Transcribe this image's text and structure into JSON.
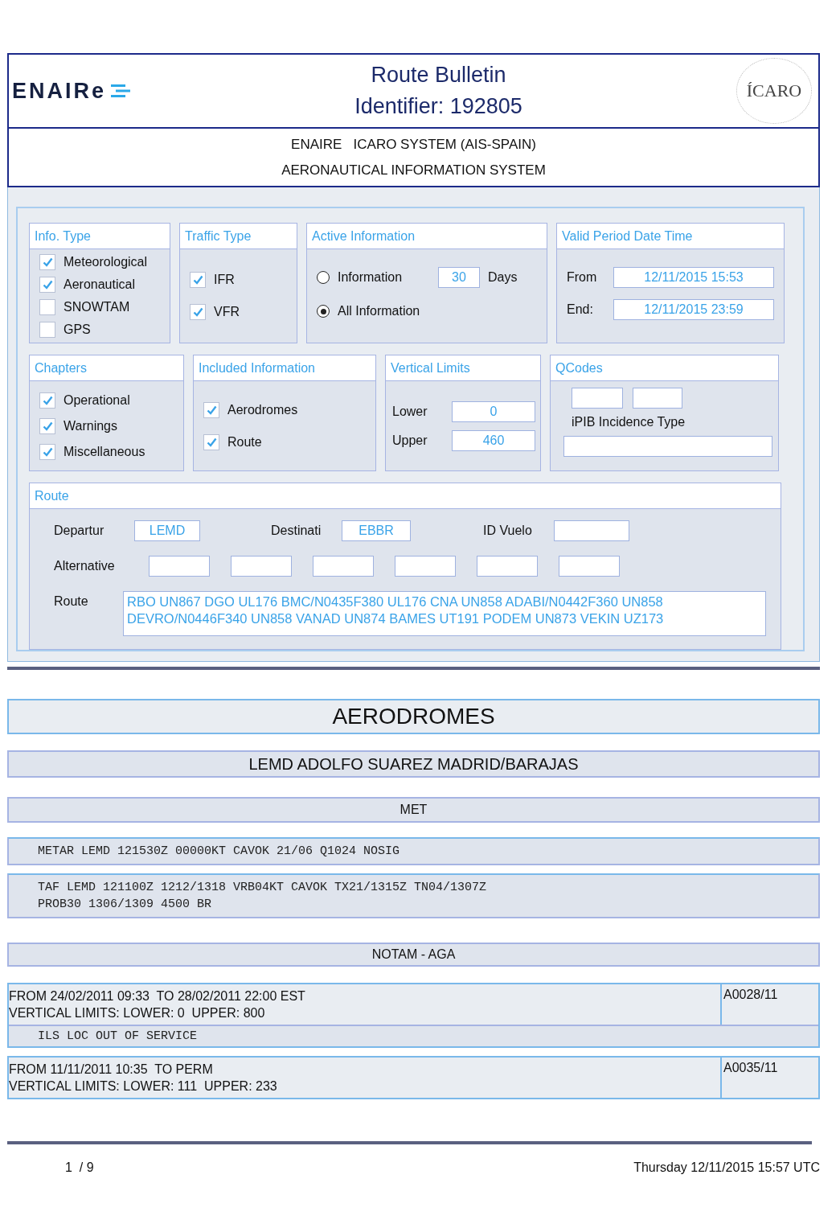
{
  "header": {
    "logo": "ENAIRe",
    "title": "Route Bulletin",
    "identifier": "Identifier: 192805",
    "emblem": "ÍCARO",
    "subtitle_lines": [
      "ENAIRE   ICARO SYSTEM (AIS-SPAIN)",
      "AERONAUTICAL INFORMATION SYSTEM"
    ]
  },
  "info_type": {
    "title": "Info. Type",
    "options": [
      {
        "label": "Meteorological",
        "checked": true
      },
      {
        "label": "Aeronautical",
        "checked": true
      },
      {
        "label": "SNOWTAM",
        "checked": false
      },
      {
        "label": "GPS",
        "checked": false
      }
    ]
  },
  "traffic_type": {
    "title": "Traffic Type",
    "options": [
      {
        "label": "IFR",
        "checked": true
      },
      {
        "label": "VFR",
        "checked": true
      }
    ]
  },
  "active_information": {
    "title": "Active Information",
    "options": [
      {
        "label": "Information",
        "selected": false,
        "value": "30",
        "unit": "Days"
      },
      {
        "label": "All Information",
        "selected": true
      }
    ]
  },
  "valid_period": {
    "title": "Valid Period Date Time",
    "fields": [
      {
        "label": "From",
        "value": "12/11/2015 15:53"
      },
      {
        "label": "End:",
        "value": "12/11/2015 23:59"
      }
    ]
  },
  "chapters": {
    "title": "Chapters",
    "options": [
      {
        "label": "Operational",
        "checked": true
      },
      {
        "label": "Warnings",
        "checked": true
      },
      {
        "label": "Miscellaneous",
        "checked": true
      }
    ]
  },
  "included_information": {
    "title": "Included Information",
    "options": [
      {
        "label": "Aerodromes",
        "checked": true
      },
      {
        "label": "Route",
        "checked": true
      }
    ]
  },
  "vertical_limits": {
    "title": "Vertical Limits",
    "fields": [
      {
        "label": "Lower",
        "value": "0"
      },
      {
        "label": "Upper",
        "value": "460"
      }
    ]
  },
  "qcodes": {
    "title": "QCodes",
    "incidence_label": "iPIB Incidence Type"
  },
  "route": {
    "title": "Route",
    "departure_label": "Departur",
    "departure": "LEMD",
    "destination_label": "Destinati",
    "destination": "EBBR",
    "flight_id_label": "ID Vuelo",
    "alternative_label": "Alternative",
    "route_label": "Route",
    "route_lines": [
      "RBO UN867 DGO UL176 BMC/N0435F380 UL176 CNA UN858 ADABI/N0442F360 UN858",
      "DEVRO/N0446F340 UN858 VANAD UN874 BAMES UT191 PODEM UN873 VEKIN UZ173"
    ]
  },
  "section_title": "AERODROMES",
  "aerodrome": "LEMD ADOLFO SUAREZ MADRID/BARAJAS",
  "met": {
    "title": "MET",
    "reports": [
      [
        "METAR LEMD 121530Z 00000KT CAVOK 21/06 Q1024 NOSIG"
      ],
      [
        "TAF LEMD 121100Z 1212/1318 VRB04KT CAVOK TX21/1315Z TN04/1307Z",
        "PROB30 1306/1309 4500 BR"
      ]
    ]
  },
  "notam": {
    "title": "NOTAM - AGA",
    "items": [
      {
        "lines": [
          "FROM 24/02/2011 09:33  TO 28/02/2011 22:00 EST",
          "VERTICAL LIMITS: LOWER: 0  UPPER: 800"
        ],
        "id": "A0028/11",
        "text": "ILS LOC OUT OF SERVICE"
      },
      {
        "lines": [
          "FROM 11/11/2011 10:35  TO PERM",
          "VERTICAL LIMITS: LOWER: 111  UPPER: 233"
        ],
        "id": "A0035/11"
      }
    ]
  },
  "footer": {
    "page": "1  / 9",
    "date": "Thursday 12/11/2015 15:57 UTC"
  }
}
